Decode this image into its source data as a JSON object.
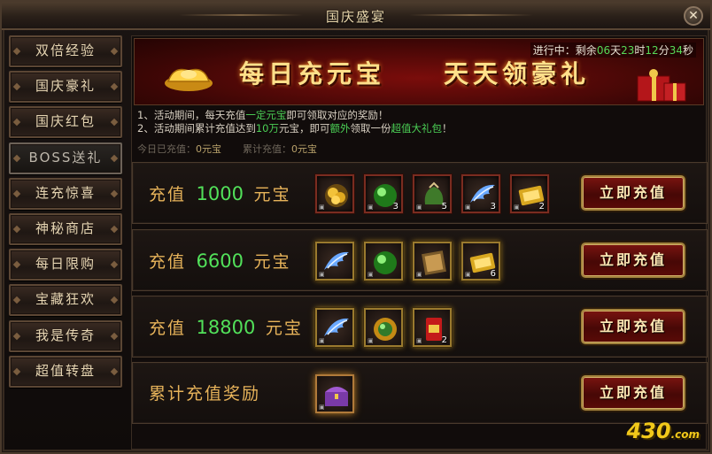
{
  "window": {
    "title": "国庆盛宴",
    "close_icon": "✕"
  },
  "sidebar": {
    "items": [
      {
        "label": "双倍经验",
        "active": false
      },
      {
        "label": "国庆豪礼",
        "active": false
      },
      {
        "label": "国庆红包",
        "active": false
      },
      {
        "label": "BOSS送礼",
        "active": true
      },
      {
        "label": "连充惊喜",
        "active": false
      },
      {
        "label": "神秘商店",
        "active": false
      },
      {
        "label": "每日限购",
        "active": false
      },
      {
        "label": "宝藏狂欢",
        "active": false
      },
      {
        "label": "我是传奇",
        "active": false
      },
      {
        "label": "超值转盘",
        "active": false
      }
    ]
  },
  "banner": {
    "slogan": "每日充元宝　　天天领豪礼",
    "countdown": {
      "prefix": "进行中：剩余",
      "days": "06",
      "u_day": "天",
      "hours": "23",
      "u_hour": "时",
      "minutes": "12",
      "u_min": "分",
      "seconds": "34",
      "u_sec": "秒"
    }
  },
  "notes": {
    "line1": {
      "a": "1、活动期间，每天充值",
      "hl": "一定元宝",
      "b": "即可领取对应的奖励！"
    },
    "line2": {
      "a": "2、活动期间累计充值达到",
      "n": "10万",
      "b": "元宝，即可",
      "hl1": "额外",
      "c": "领取一份",
      "hl2": "超值大礼包",
      "d": "！"
    }
  },
  "tally": {
    "today_label": "今日已充值：",
    "today_value": "0元宝",
    "total_label": "累计充值：",
    "total_value": "0元宝"
  },
  "rows": [
    {
      "prefix": "充值",
      "amount": "1000",
      "suffix": "元宝",
      "button": "立即充值",
      "items": [
        {
          "icon": "gold-nugget-icon",
          "qty": ""
        },
        {
          "icon": "green-orb-icon",
          "qty": "3"
        },
        {
          "icon": "jade-pouch-icon",
          "qty": "5"
        },
        {
          "icon": "blue-wing-icon",
          "qty": "3"
        },
        {
          "icon": "gold-scroll-icon",
          "qty": "2"
        }
      ]
    },
    {
      "prefix": "充值",
      "amount": "6600",
      "suffix": "元宝",
      "button": "立即充值",
      "items": [
        {
          "icon": "blue-wing-icon",
          "qty": ""
        },
        {
          "icon": "green-orb-icon",
          "qty": ""
        },
        {
          "icon": "book-icon",
          "qty": ""
        },
        {
          "icon": "gold-scroll-icon",
          "qty": "6"
        }
      ]
    },
    {
      "prefix": "充值",
      "amount": "18800",
      "suffix": "元宝",
      "button": "立即充值",
      "items": [
        {
          "icon": "blue-wing-icon",
          "qty": ""
        },
        {
          "icon": "gold-orb-icon",
          "qty": ""
        },
        {
          "icon": "red-envelope-icon",
          "qty": "2"
        }
      ]
    },
    {
      "prefix": "累计充值奖励",
      "amount": "",
      "suffix": "",
      "button": "立即充值",
      "items": [
        {
          "icon": "treasure-chest-icon",
          "qty": ""
        }
      ]
    }
  ],
  "logo": {
    "main": "430",
    "sub": ".com"
  }
}
